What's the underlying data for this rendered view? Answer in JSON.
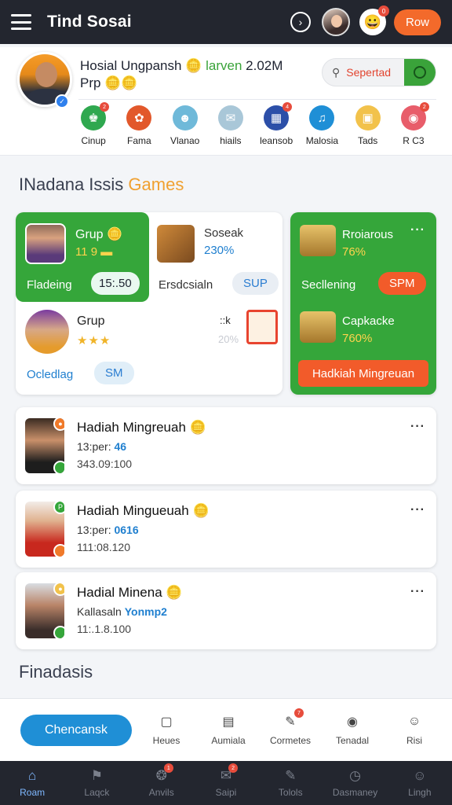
{
  "header": {
    "title": "Tind Sosai",
    "action_label": "Row",
    "coin_badge": "0"
  },
  "profile": {
    "line1_name": "Hosial Ungpansh",
    "line1_tag": "larven",
    "line1_value": "2.02M",
    "line2": "Prp",
    "search_placeholder": "Sepertad"
  },
  "categories": [
    {
      "label": "Cinup",
      "icon": "basket-icon",
      "color": "#2fa84f",
      "badge": "2"
    },
    {
      "label": "Fama",
      "icon": "food-icon",
      "color": "#e2582b",
      "badge": ""
    },
    {
      "label": "Vlanao",
      "icon": "person-icon",
      "color": "#6fb9d9",
      "badge": ""
    },
    {
      "label": "hiails",
      "icon": "chat-icon",
      "color": "#a9c7d8",
      "badge": ""
    },
    {
      "label": "leansob",
      "icon": "grid-icon",
      "color": "#2c4fa8",
      "badge": "4"
    },
    {
      "label": "Malosia",
      "icon": "music-icon",
      "color": "#1f8fd6",
      "badge": ""
    },
    {
      "label": "Tads",
      "icon": "frame-icon",
      "color": "#f2c24b",
      "badge": ""
    },
    {
      "label": "R C3",
      "icon": "fruit-icon",
      "color": "#e85d6a",
      "badge": "2"
    }
  ],
  "section": {
    "title_main": "INadana Issis",
    "title_accent": "Games"
  },
  "grid": {
    "tile1": {
      "name": "Grup",
      "value": "11 9",
      "label": "Fladeing",
      "time": "15:.50"
    },
    "tile2": {
      "name": "Soseak",
      "value": "230%",
      "label": "Ersdcsialn",
      "pill": "SUP"
    },
    "tile3": {
      "name": "Grup",
      "stars": "★★★",
      "k": "::k",
      "pct": "20%",
      "label": "Ocledlag",
      "pill": "SM"
    }
  },
  "green_card": {
    "item1": {
      "name": "Rroiarous",
      "value": "76%"
    },
    "label": "Secllening",
    "pill": "SPM",
    "item2": {
      "name": "Capkacke",
      "value": "760%"
    },
    "button": "Hadkiah Mingreuan"
  },
  "list": [
    {
      "title": "Hadiah Mingreuah",
      "sub_prefix": "13:per:",
      "sub_value": "46",
      "num": "343.09:100",
      "badge_color": "#f07a2a",
      "badge_text": "●",
      "badge2_color": "#35a63a",
      "thumb": "linear-gradient(180deg,#3a2b22 0%,#c9906a 40%,#1d1d1d 80%)"
    },
    {
      "title": "Hadiah Minguеuah",
      "sub_prefix": "13:per:",
      "sub_value": "0616",
      "num": "111:08.120",
      "badge_color": "#35a63a",
      "badge_text": "P",
      "badge2_color": "#f07a2a",
      "thumb": "linear-gradient(180deg,#f2ece8 0%,#e0b28f 35%,#c8281e 75%)"
    },
    {
      "title": "Hadial Minena",
      "sub_prefix": "Kallasaln",
      "sub_value": "Yonmp2",
      "num": "11:.1.8.100",
      "badge_color": "#f2c24b",
      "badge_text": "●",
      "badge2_color": "#35a63a",
      "thumb": "linear-gradient(180deg,#d9dde2 0%,#b98468 40%,#3a2d2a 85%)"
    }
  ],
  "footer_title": "Finadasis",
  "action_bar": {
    "cta": "Chencansk",
    "items": [
      {
        "label": "Heues",
        "icon": "square-icon",
        "badge": ""
      },
      {
        "label": "Aumiala",
        "icon": "calendar-icon",
        "badge": ""
      },
      {
        "label": "Cormetes",
        "icon": "pencil-icon",
        "badge": "7"
      },
      {
        "label": "Tenadal",
        "icon": "palette-icon",
        "badge": ""
      },
      {
        "label": "Risi",
        "icon": "user-icon",
        "badge": ""
      }
    ]
  },
  "nav": [
    {
      "label": "Roam",
      "icon": "home-icon",
      "badge": "",
      "active": true
    },
    {
      "label": "Laqck",
      "icon": "bookmark-icon",
      "badge": "",
      "active": false
    },
    {
      "label": "Anvils",
      "icon": "compass-icon",
      "badge": "1",
      "active": false
    },
    {
      "label": "Saipi",
      "icon": "chat-icon",
      "badge": "2",
      "active": false
    },
    {
      "label": "Tolols",
      "icon": "edit-icon",
      "badge": "",
      "active": false
    },
    {
      "label": "Dasmaney",
      "icon": "clock-icon",
      "badge": "",
      "active": false
    },
    {
      "label": "Lingh",
      "icon": "profile-icon",
      "badge": "",
      "active": false
    }
  ]
}
